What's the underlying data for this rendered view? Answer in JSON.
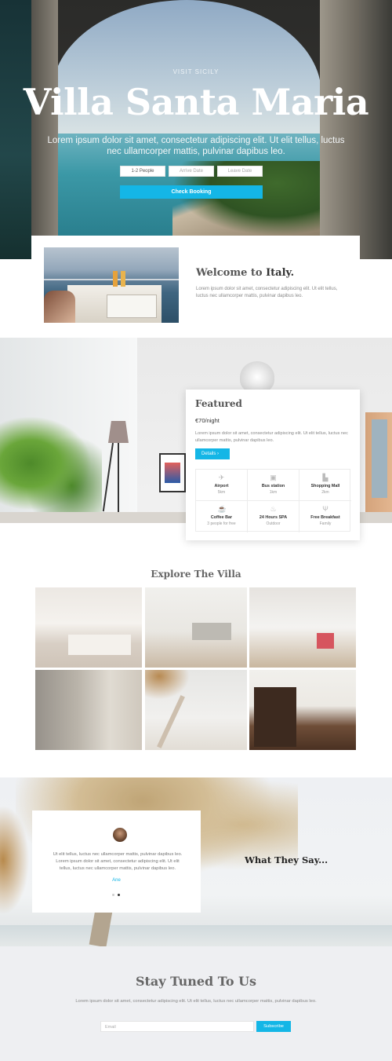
{
  "hero": {
    "kicker": "VISIT SICILY",
    "title": "Villa Santa Maria",
    "subtitle": "Lorem ipsum dolor sit amet, consectetur adipiscing elit. Ut elit tellus, luctus nec ullamcorper mattis, pulvinar dapibus leo.",
    "booking": {
      "people_value": "1-2 People",
      "arrive_placeholder": "Arrive Date",
      "leave_placeholder": "Leave Date",
      "button_label": "Check Booking"
    }
  },
  "welcome": {
    "title_prefix": "Welcome to ",
    "title_bold": "Italy.",
    "text": "Lorem ipsum dolor sit amet, consectetur adipiscing elit. Ut elit tellus, luctus nec ullamcorper mattis, pulvinar dapibus leo."
  },
  "featured": {
    "title": "Featured",
    "price": "€70/night",
    "text": "Lorem ipsum dolor sit amet, consectetur adipiscing elit. Ut elit tellus, luctus nec ullamcorper mattis, pulvinar dapibus leo.",
    "button_label": "Details",
    "button_icon": "›",
    "amenities": [
      {
        "icon": "plane-icon",
        "glyph": "✈",
        "title": "Airport",
        "sub": "5km"
      },
      {
        "icon": "bus-icon",
        "glyph": "▣",
        "title": "Bus station",
        "sub": "1km"
      },
      {
        "icon": "store-icon",
        "glyph": "▙",
        "title": "Shopping Mall",
        "sub": "2km"
      },
      {
        "icon": "coffee-icon",
        "glyph": "☕",
        "title": "Coffee Bar",
        "sub": "3 people for free"
      },
      {
        "icon": "bath-icon",
        "glyph": "♨",
        "title": "24 Hours SPA",
        "sub": "Outdoor"
      },
      {
        "icon": "utensils-icon",
        "glyph": "Ψ",
        "title": "Free Breakfast",
        "sub": "Family"
      }
    ]
  },
  "explore": {
    "title": "Explore The Villa"
  },
  "testimonial": {
    "text": "Ut elit tellus, luctus nec ullamcorper mattis, pulvinar dapibus leo. Lorem ipsum dolor sit amet, consectetur adipiscing elit. Ut elit tellus, luctus nec ullamcorper mattis, pulvinar dapibus leo.",
    "name": "Ane",
    "heading": "What They Say..."
  },
  "newsletter": {
    "title": "Stay Tuned To Us",
    "text": "Lorem ipsum dolor sit amet, consectetur adipiscing elit. Ut elit tellus, luctus nec ullamcorper mattis, pulvinar dapibus leo.",
    "email_placeholder": "Email",
    "button_label": "Subscribe"
  },
  "colors": {
    "accent": "#14b6e6",
    "text_dark": "#333333",
    "text_muted": "#888888"
  }
}
